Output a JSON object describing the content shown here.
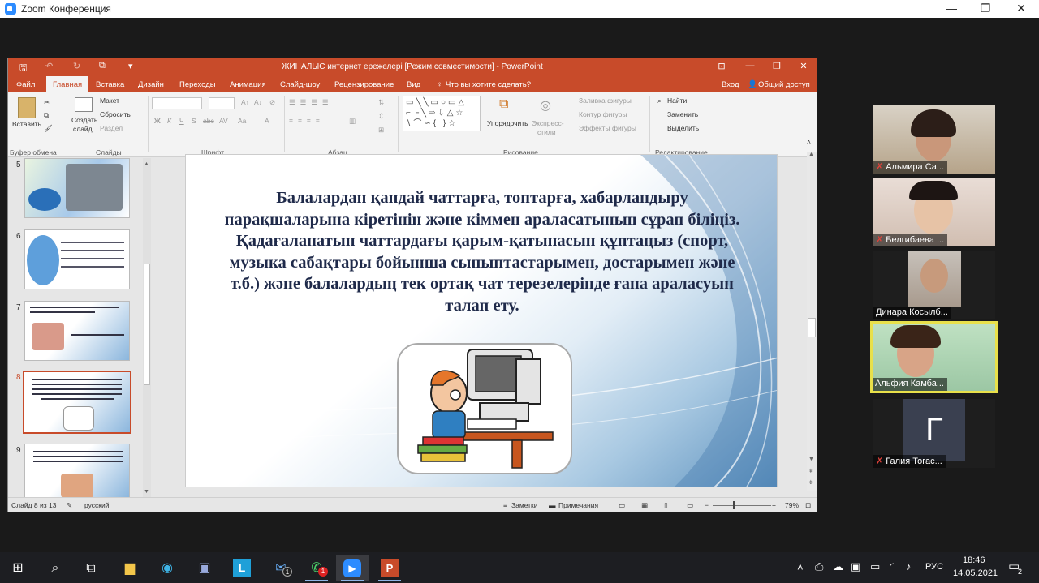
{
  "zoom": {
    "title": "Zoom Конференция",
    "minimize": "—",
    "maximize": "❐",
    "close": "✕"
  },
  "ppt": {
    "title": "ЖИНАЛЫС интернет ережелері [Режим совместимости] - PowerPoint",
    "login": "Вход",
    "share": "Общий доступ",
    "tabs": [
      "Файл",
      "Главная",
      "Вставка",
      "Дизайн",
      "Переходы",
      "Анимация",
      "Слайд-шоу",
      "Рецензирование",
      "Вид"
    ],
    "tell_me": "Что вы хотите сделать?",
    "ribbon": {
      "paste": "Вставить",
      "clipboard_group": "Буфер обмена",
      "new_slide_1": "Создать",
      "new_slide_2": "слайд",
      "layout": "Макет",
      "reset": "Сбросить",
      "section": "Раздел",
      "slides_group": "Слайды",
      "font_group": "Шрифт",
      "paragraph_group": "Абзац",
      "arrange": "Упорядочить",
      "quick_styles_1": "Экспресс-",
      "quick_styles_2": "стили",
      "shape_fill": "Заливка фигуры",
      "shape_outline": "Контур фигуры",
      "shape_effects": "Эффекты фигуры",
      "drawing_group": "Рисование",
      "find": "Найти",
      "replace": "Заменить",
      "select": "Выделить",
      "editing_group": "Редактирование",
      "font_buttons": [
        "Ж",
        "К",
        "Ч",
        "S",
        "abc",
        "AV",
        "Aa",
        "A"
      ]
    },
    "slide_numbers": [
      "5",
      "6",
      "7",
      "8",
      "9"
    ],
    "slide_text": "Балалардан қандай чаттарға, топтарға, хабарландыру парақшаларына кіретінін және кіммен араласатынын сұрап біліңіз. Қадағаланатын чаттардағы қарым-қатынасын құптаңыз (спорт, музыка сабақтары бойынша сыныптастарымен, достарымен және т.б.) және балалардың тек ортақ чат терезелерінде ғана араласуын талап ету.",
    "status": {
      "slide_of": "Слайд 8 из 13",
      "language": "русский",
      "notes": "Заметки",
      "comments": "Примечания",
      "zoom": "79%"
    }
  },
  "participants": [
    {
      "name": "Альмира Са...",
      "muted": true
    },
    {
      "name": "Белгибаева ...",
      "muted": true
    },
    {
      "name": "Динара Косылб...",
      "muted": false
    },
    {
      "name": "Альфия Камба...",
      "muted": false,
      "speaking": true
    },
    {
      "name": "Галия Тогас...",
      "muted": true,
      "initial": "Г"
    }
  ],
  "taskbar": {
    "language": "РУС",
    "time": "18:46",
    "date": "14.05.2021",
    "notifications": "2",
    "badge_mail": "1",
    "badge_whatsapp": "1"
  },
  "colors": {
    "ppt_accent": "#c84b2a",
    "zoom_accent": "#2d8cff",
    "speaker_border": "#e8e04a",
    "muted": "#e2423b"
  }
}
